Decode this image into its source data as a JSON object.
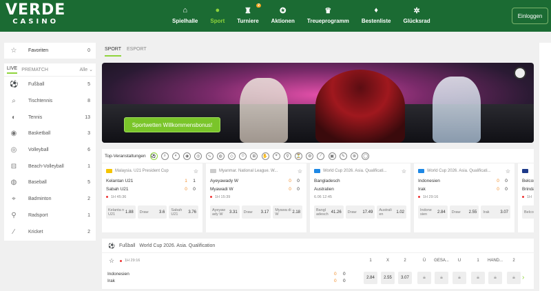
{
  "brand": {
    "logo_top": "VERDE",
    "logo_bottom": "CASINO"
  },
  "nav": [
    {
      "label": "Spielhalle",
      "icon": "⌂"
    },
    {
      "label": "Sport",
      "icon": "●",
      "active": true
    },
    {
      "label": "Turniere",
      "icon": "♜",
      "badge": "2"
    },
    {
      "label": "Aktionen",
      "icon": "✪"
    },
    {
      "label": "Treueprogramm",
      "icon": "♛"
    },
    {
      "label": "Bestenliste",
      "icon": "♦"
    },
    {
      "label": "Glücksrad",
      "icon": "✲"
    }
  ],
  "login": "Einloggen",
  "favorites": {
    "label": "Favoriten",
    "count": "0",
    "icon": "☆"
  },
  "sidebar": {
    "tabs": [
      "LIVE",
      "PREMATCH"
    ],
    "filter": "Alle ⌄",
    "items": [
      {
        "label": "Fußball",
        "count": "5",
        "icon": "⚽"
      },
      {
        "label": "Tischtennis",
        "count": "8",
        "icon": "⌕"
      },
      {
        "label": "Tennis",
        "count": "13",
        "icon": "◐"
      },
      {
        "label": "Basketball",
        "count": "3",
        "icon": "◉"
      },
      {
        "label": "Volleyball",
        "count": "6",
        "icon": "◎"
      },
      {
        "label": "Beach-Volleyball",
        "count": "1",
        "icon": "⊟"
      },
      {
        "label": "Baseball",
        "count": "5",
        "icon": "◍"
      },
      {
        "label": "Badminton",
        "count": "2",
        "icon": "⌖"
      },
      {
        "label": "Radsport",
        "count": "1",
        "icon": "⚲"
      },
      {
        "label": "Kricket",
        "count": "2",
        "icon": "∕"
      }
    ]
  },
  "main_tabs": [
    "SPORT",
    "ESPORT"
  ],
  "banner": {
    "button": "Sportwetten Willkommensbonus!"
  },
  "top_events": {
    "title": "Top-Veranstaltungen",
    "icon_count": 20
  },
  "cards": [
    {
      "league": "Malaysia. U21 President Cup",
      "flag": "#f5c400",
      "home": "Kelantan U21",
      "away": "Sabah U21",
      "hs": [
        "1",
        "1"
      ],
      "as": [
        "0",
        "0"
      ],
      "live": true,
      "time": "1H  45:36",
      "odds": [
        {
          "label": "Kelanta n U21",
          "value": "1.88"
        },
        {
          "label": "Draw",
          "value": "3.6"
        },
        {
          "label": "Sabah U21",
          "value": "3.76"
        }
      ]
    },
    {
      "league": "Myanmar. National League. W...",
      "flag": "#cccccc",
      "home": "Ayeyawady W",
      "away": "Myawadi W",
      "hs": [
        "0",
        "0"
      ],
      "as": [
        "0",
        "0"
      ],
      "live": true,
      "time": "1H  15:39",
      "odds": [
        {
          "label": "Ayeyaw ady W",
          "value": "3.31"
        },
        {
          "label": "Draw",
          "value": "3.17"
        },
        {
          "label": "Myawa di W",
          "value": "2.18"
        }
      ]
    },
    {
      "league": "World Cup 2026. Asia. Qualificati...",
      "flag": "#1e88e5",
      "home": "Bangladesch",
      "away": "Australien",
      "hs": [
        "",
        ""
      ],
      "as": [
        "",
        ""
      ],
      "live": false,
      "time": "6.06  12:45",
      "odds": [
        {
          "label": "Bangl adesch",
          "value": "41.26"
        },
        {
          "label": "Draw",
          "value": "17.49"
        },
        {
          "label": "Australi en",
          "value": "1.02"
        }
      ]
    },
    {
      "league": "World Cup 2026. Asia. Qualificati...",
      "flag": "#1e88e5",
      "home": "Indonesien",
      "away": "Irak",
      "hs": [
        "0",
        "0"
      ],
      "as": [
        "0",
        "0"
      ],
      "live": true,
      "time": "1H  29:16",
      "odds": [
        {
          "label": "Indone sien",
          "value": "2.84"
        },
        {
          "label": "Draw",
          "value": "2.55"
        },
        {
          "label": "Irak",
          "value": "3.07"
        }
      ]
    },
    {
      "league": "",
      "flag": "#1e3a8a",
      "home": "Belcon",
      "away": "Brindab",
      "hs": [
        "",
        ""
      ],
      "as": [
        "",
        ""
      ],
      "live": true,
      "time": "1H",
      "odds": [
        {
          "label": "Belco nen",
          "value": ""
        }
      ]
    }
  ],
  "event": {
    "sport": "Fußball",
    "league": "World Cup 2026. Asia. Qualification",
    "time": "1H  29:16",
    "home": "Indonesien",
    "away": "Irak",
    "score_home": [
      "0",
      "0"
    ],
    "score_away": [
      "0",
      "0"
    ],
    "cols": [
      "1",
      "X",
      "2",
      "Ü",
      "GESA...",
      "U",
      "1",
      "HAND...",
      "2"
    ],
    "odds": [
      "2.84",
      "2.55",
      "3.07"
    ]
  }
}
